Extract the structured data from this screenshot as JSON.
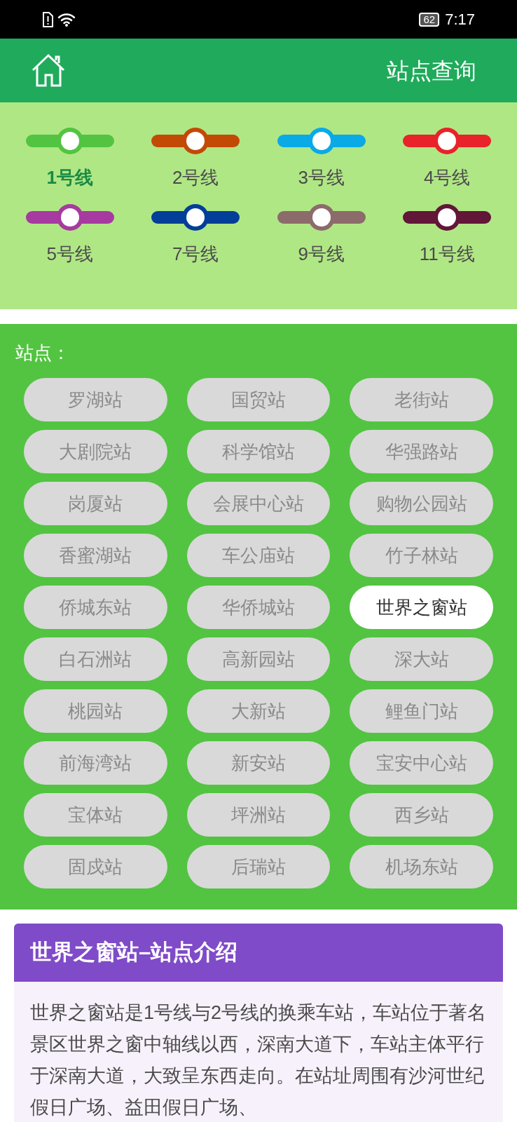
{
  "status_bar": {
    "battery": "62",
    "time": "7:17"
  },
  "header": {
    "title": "站点查询"
  },
  "lines": [
    {
      "label": "1号线",
      "color": "#52c441",
      "selected": true
    },
    {
      "label": "2号线",
      "color": "#c24a05",
      "selected": false
    },
    {
      "label": "3号线",
      "color": "#0aaae6",
      "selected": false
    },
    {
      "label": "4号线",
      "color": "#e8232a",
      "selected": false
    },
    {
      "label": "5号线",
      "color": "#a63aa0",
      "selected": false
    },
    {
      "label": "7号线",
      "color": "#033f98",
      "selected": false
    },
    {
      "label": "9号线",
      "color": "#8c6b6b",
      "selected": false
    },
    {
      "label": "11号线",
      "color": "#621638",
      "selected": false
    }
  ],
  "stations_label": "站点：",
  "stations": [
    {
      "name": "罗湖站",
      "selected": false
    },
    {
      "name": "国贸站",
      "selected": false
    },
    {
      "name": "老街站",
      "selected": false
    },
    {
      "name": "大剧院站",
      "selected": false
    },
    {
      "name": "科学馆站",
      "selected": false
    },
    {
      "name": "华强路站",
      "selected": false
    },
    {
      "name": "岗厦站",
      "selected": false
    },
    {
      "name": "会展中心站",
      "selected": false
    },
    {
      "name": "购物公园站",
      "selected": false
    },
    {
      "name": "香蜜湖站",
      "selected": false
    },
    {
      "name": "车公庙站",
      "selected": false
    },
    {
      "name": "竹子林站",
      "selected": false
    },
    {
      "name": "侨城东站",
      "selected": false
    },
    {
      "name": "华侨城站",
      "selected": false
    },
    {
      "name": "世界之窗站",
      "selected": true
    },
    {
      "name": "白石洲站",
      "selected": false
    },
    {
      "name": "高新园站",
      "selected": false
    },
    {
      "name": "深大站",
      "selected": false
    },
    {
      "name": "桃园站",
      "selected": false
    },
    {
      "name": "大新站",
      "selected": false
    },
    {
      "name": "鲤鱼门站",
      "selected": false
    },
    {
      "name": "前海湾站",
      "selected": false
    },
    {
      "name": "新安站",
      "selected": false
    },
    {
      "name": "宝安中心站",
      "selected": false
    },
    {
      "name": "宝体站",
      "selected": false
    },
    {
      "name": "坪洲站",
      "selected": false
    },
    {
      "name": "西乡站",
      "selected": false
    },
    {
      "name": "固戍站",
      "selected": false
    },
    {
      "name": "后瑞站",
      "selected": false
    },
    {
      "name": "机场东站",
      "selected": false
    }
  ],
  "intro": {
    "title": "世界之窗站–站点介绍",
    "text": "世界之窗站是1号线与2号线的换乘车站，车站位于著名景区世界之窗中轴线以西，深南大道下，车站主体平行于深南大道，大致呈东西走向。在站址周围有沙河世纪假日广场、益田假日广场、"
  }
}
